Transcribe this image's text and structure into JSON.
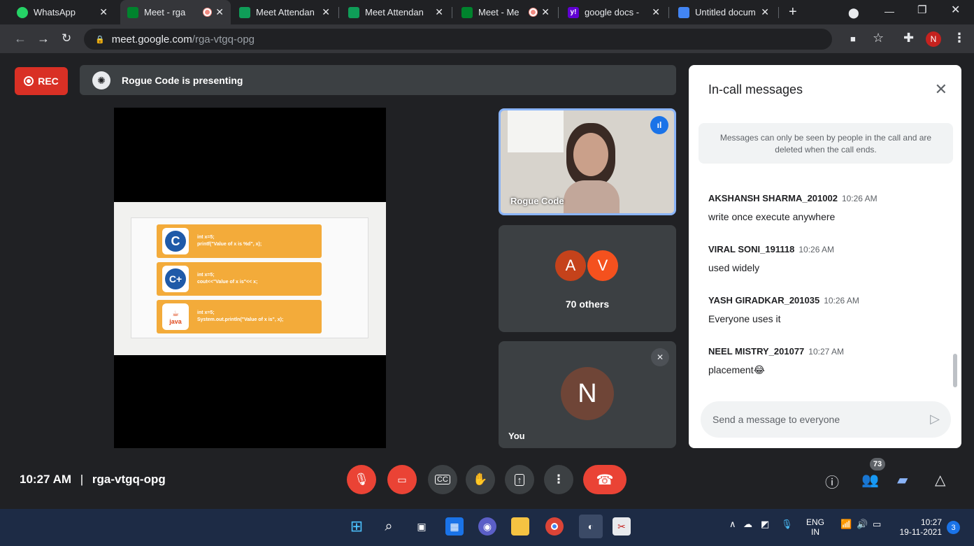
{
  "browser": {
    "tabs": [
      {
        "title": "WhatsApp",
        "favicon_color": "#25d366",
        "recording": false,
        "active": false
      },
      {
        "title": "Meet - rga",
        "favicon_color": "#00832d",
        "recording": true,
        "active": true
      },
      {
        "title": "Meet Attendan",
        "favicon_color": "#0f9d58",
        "recording": false,
        "active": false
      },
      {
        "title": "Meet Attendan",
        "favicon_color": "#0f9d58",
        "recording": false,
        "active": false
      },
      {
        "title": "Meet - Me",
        "favicon_color": "#00832d",
        "recording": true,
        "active": false
      },
      {
        "title": "google docs - ",
        "favicon_color": "#6001d2",
        "recording": false,
        "active": false
      },
      {
        "title": "Untitled docum",
        "favicon_color": "#4285f4",
        "recording": false,
        "active": false
      }
    ],
    "url_host": "meet.google.com",
    "url_path": "/rga-vtgq-opg",
    "profile_initial": "N"
  },
  "meet": {
    "rec_label": "REC",
    "presenting_text": "Rogue Code is presenting",
    "slide": {
      "cards": [
        {
          "logo": "C",
          "code": "int x=5;\nprintf(\"Value of x is %d\", x);"
        },
        {
          "logo": "C++",
          "code": "int x=5;\ncout<<\"Value of x is\"<< x;"
        },
        {
          "logo": "java",
          "code": "int x=5;\nSystem.out.println(\"Value of x is\", x);"
        }
      ]
    },
    "tiles": {
      "speaker_name": "Rogue Code",
      "others_avatars": [
        "A",
        "V"
      ],
      "others_label": "70 others",
      "self_initial": "N",
      "self_label": "You"
    },
    "bottom": {
      "time": "10:27 AM",
      "separator": "|",
      "meeting_code": "rga-vtgq-opg",
      "participant_count": "73"
    }
  },
  "chat": {
    "title": "In-call messages",
    "notice": "Messages can only be seen by people in the call and are deleted when the call ends.",
    "messages": [
      {
        "sender": "AKSHANSH SHARMA_201002",
        "time": "10:26 AM",
        "text": "write once execute anywhere"
      },
      {
        "sender": "VIRAL SONI_191118",
        "time": "10:26 AM",
        "text": "used widely"
      },
      {
        "sender": "YASH GIRADKAR_201035",
        "time": "10:26 AM",
        "text": "Everyone uses it"
      },
      {
        "sender": "NEEL MISTRY_201077",
        "time": "10:27 AM",
        "text": "placement😂"
      }
    ],
    "input_placeholder": "Send a message to everyone"
  },
  "taskbar": {
    "lang": "ENG",
    "region": "IN",
    "time": "10:27",
    "date": "19-11-2021",
    "notifications": "3"
  },
  "colors": {
    "accent_blue": "#1a73e8",
    "danger_red": "#ea4335",
    "rec_red": "#d93025",
    "card_orange": "#f3ab3a"
  }
}
